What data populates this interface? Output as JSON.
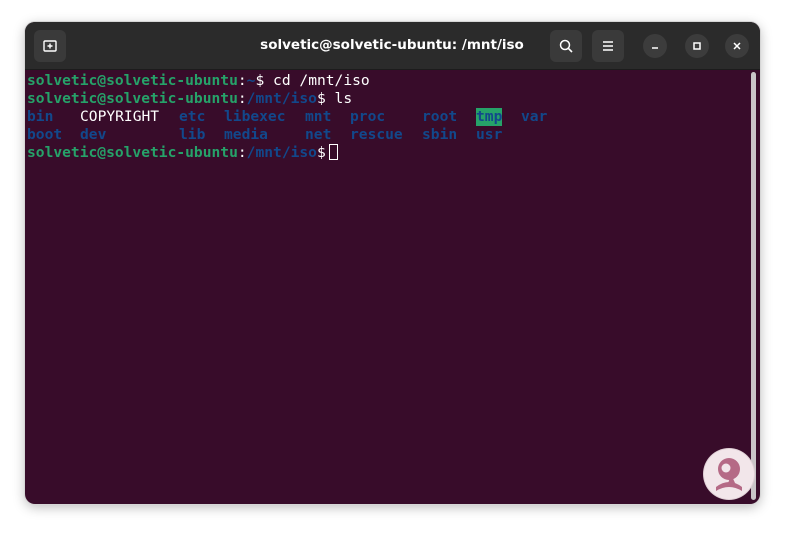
{
  "window": {
    "title": "solvetic@solvetic-ubuntu: /mnt/iso",
    "buttons": {
      "new_tab": "new-tab-icon",
      "search": "search-icon",
      "menu": "hamburger-menu-icon",
      "minimize": "minimize-icon",
      "maximize": "maximize-icon",
      "close": "close-icon"
    }
  },
  "terminal": {
    "lines": [
      {
        "user": "solvetic@solvetic-ubuntu",
        "sep": ":",
        "path": "~",
        "prompt": "$",
        "command": " cd /mnt/iso"
      },
      {
        "user": "solvetic@solvetic-ubuntu",
        "sep": ":",
        "path": "/mnt/iso",
        "prompt": "$",
        "command": " ls"
      },
      {
        "user": "solvetic@solvetic-ubuntu",
        "sep": ":",
        "path": "/mnt/iso",
        "prompt": "$",
        "command": " "
      }
    ],
    "ls_output": [
      [
        "bin",
        "COPYRIGHT",
        "etc",
        "libexec",
        "mnt",
        "proc",
        "root",
        "tmp",
        "var"
      ],
      [
        "boot",
        "dev",
        "lib",
        "media",
        "net",
        "rescue",
        "sbin",
        "usr"
      ]
    ]
  },
  "colors": {
    "background": "#380c2a",
    "user": "#26a269",
    "path": "#12488b",
    "directory": "#12488b",
    "highlight_bg": "#26a269",
    "titlebar": "#2b2b2b"
  },
  "watermark": {
    "icon": "solvetic-logo-icon"
  }
}
